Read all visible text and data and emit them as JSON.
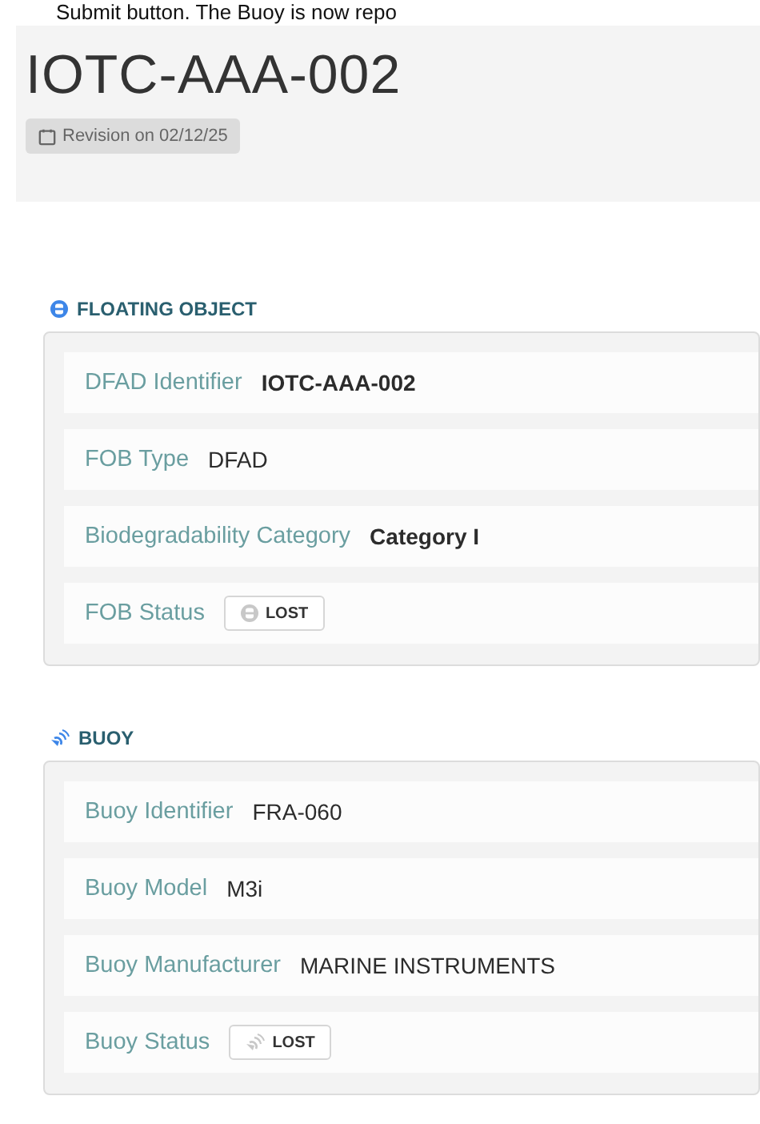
{
  "caption": "Submit button. The Buoy is now repo",
  "header": {
    "title": "IOTC-AAA-002",
    "revision": "Revision on 02/12/25"
  },
  "sections": [
    {
      "kind": "floating_object",
      "title": "FLOATING OBJECT",
      "fields": [
        {
          "kind": "text",
          "label": "DFAD Identifier",
          "value": "IOTC-AAA-002"
        },
        {
          "kind": "text",
          "label": "FOB Type",
          "value": "DFAD"
        },
        {
          "kind": "text",
          "label": "Biodegradability Category",
          "value": "Category I"
        },
        {
          "kind": "status",
          "label": "FOB Status",
          "value": "LOST"
        }
      ]
    },
    {
      "kind": "buoy",
      "title": "BUOY",
      "fields": [
        {
          "kind": "text",
          "label": "Buoy Identifier",
          "value": "FRA-060"
        },
        {
          "kind": "text",
          "label": "Buoy Model",
          "value": "M3i"
        },
        {
          "kind": "text",
          "label": "Buoy Manufacturer",
          "value": "MARINE INSTRUMENTS"
        },
        {
          "kind": "status",
          "label": "Buoy Status",
          "value": "LOST"
        }
      ]
    }
  ]
}
